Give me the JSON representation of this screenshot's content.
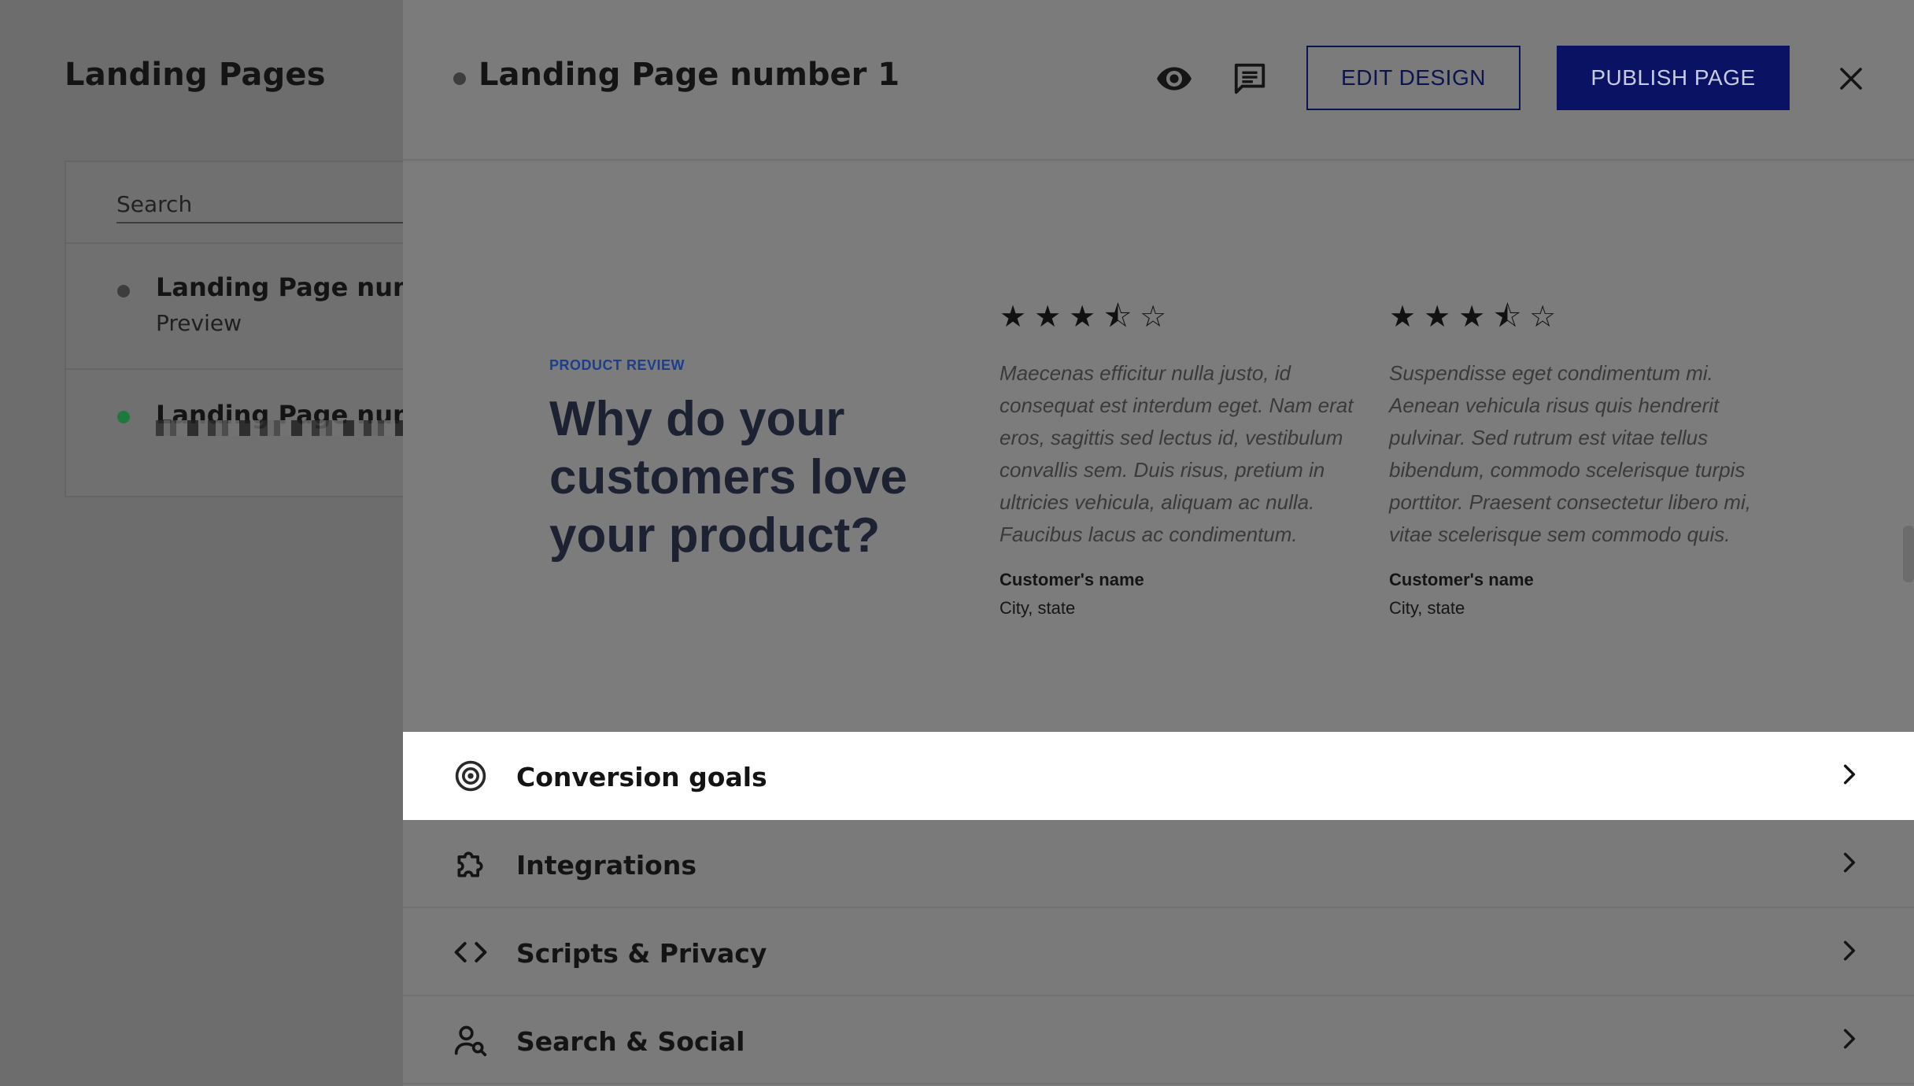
{
  "sidebar": {
    "title": "Landing Pages",
    "search_placeholder": "Search",
    "items": [
      {
        "title": "Landing Page numbe",
        "subtitle": "Preview",
        "status_color": "#3d3d3d"
      },
      {
        "title": "Landing Page numbe",
        "subtitle": "",
        "status_color": "#1e7a3c"
      }
    ]
  },
  "header": {
    "title": "Landing Page number 1",
    "status_color": "#3d3d3d",
    "preview_icon": "eye-icon",
    "comments_icon": "comment-icon",
    "edit_label": "EDIT DESIGN",
    "publish_label": "PUBLISH PAGE",
    "close_icon": "close-icon",
    "accent": "#0a1264"
  },
  "preview": {
    "eyebrow": "PRODUCT REVIEW",
    "headline": "Why do your customers love your product?",
    "reviews": [
      {
        "rating": 3.5,
        "stars": "★★★⯪☆",
        "quote": "Maecenas efficitur nulla justo, id consequat est interdum eget. Nam erat eros, sagittis sed lectus id, vestibulum convallis sem. Duis risus, pretium in ultricies vehicula, aliquam ac nulla. Faucibus lacus ac condimentum.",
        "name": "Customer's name",
        "location": "City, state"
      },
      {
        "rating": 3.5,
        "stars": "★★★⯪☆",
        "quote": "Suspendisse eget condimentum mi. Aenean vehicula risus quis hendrerit pulvinar. Sed rutrum est vitae tellus bibendum, commodo scelerisque turpis porttitor. Praesent consectetur libero mi, vitae scelerisque sem commodo quis.",
        "name": "Customer's name",
        "location": "City, state"
      }
    ]
  },
  "settings": [
    {
      "label": "Conversion goals",
      "icon": "target-icon",
      "active": true
    },
    {
      "label": "Integrations",
      "icon": "puzzle-icon",
      "active": false
    },
    {
      "label": "Scripts & Privacy",
      "icon": "code-icon",
      "active": false
    },
    {
      "label": "Search & Social",
      "icon": "person-search-icon",
      "active": false
    }
  ]
}
